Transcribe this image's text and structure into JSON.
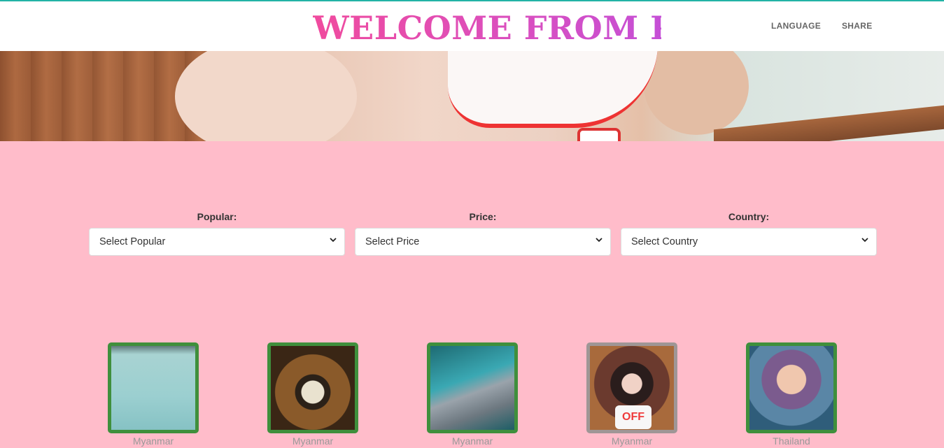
{
  "header": {
    "title": "WELCOME FROM PIN",
    "nav": [
      {
        "label": "LANGUAGE"
      },
      {
        "label": "SHARE"
      }
    ]
  },
  "filters": [
    {
      "label": "Popular:",
      "selected": "Select Popular"
    },
    {
      "label": "Price:",
      "selected": "Select Price"
    },
    {
      "label": "Country:",
      "selected": "Select Country"
    }
  ],
  "cards": [
    {
      "country": "Myanmar",
      "status": "online"
    },
    {
      "country": "Myanmar",
      "status": "online"
    },
    {
      "country": "Myanmar",
      "status": "online"
    },
    {
      "country": "Myanmar",
      "status": "off",
      "badge": "OFF"
    },
    {
      "country": "Thailand",
      "status": "online"
    }
  ],
  "colors": {
    "background": "#ffbcca",
    "online_border": "#3f8f3c",
    "off_border": "#9f9696",
    "title_pink": "#e94aa8",
    "top_line": "#22b3a6"
  }
}
